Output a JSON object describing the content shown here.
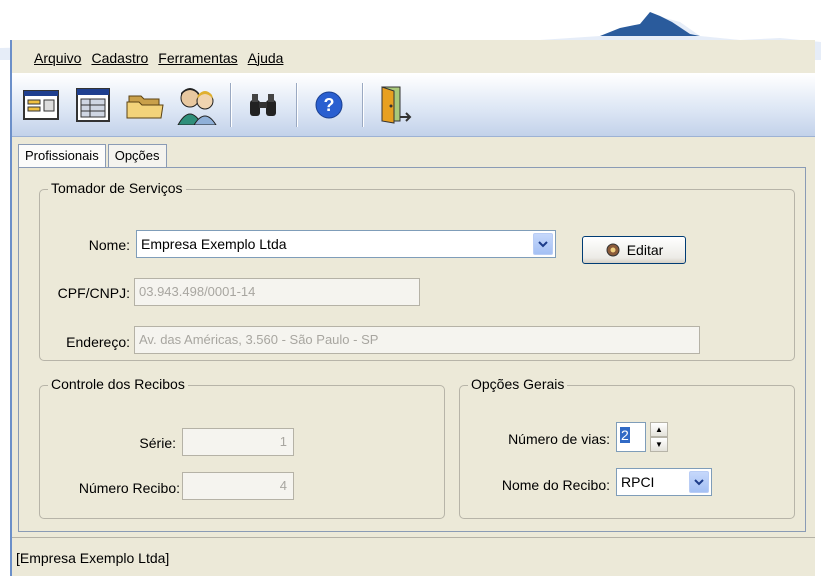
{
  "menu": {
    "items": [
      "Arquivo",
      "Cadastro",
      "Ferramentas",
      "Ajuda"
    ]
  },
  "toolbar": {
    "icons": [
      "form-icon",
      "table-icon",
      "folders-icon",
      "users-icon",
      "binoculars-icon",
      "help-icon",
      "exit-door-icon"
    ]
  },
  "tabs": [
    "Profissionais",
    "Opções"
  ],
  "tomador": {
    "legend": "Tomador de Serviços",
    "nome_label": "Nome:",
    "nome_value": "Empresa Exemplo Ltda",
    "editar_label": "Editar",
    "cpf_label": "CPF/CNPJ:",
    "cpf_value": "03.943.498/0001-14",
    "endereco_label": "Endereço:",
    "endereco_value": "Av. das Américas, 3.560 - São Paulo - SP"
  },
  "controle": {
    "legend": "Controle dos Recibos",
    "serie_label": "Série:",
    "serie_value": "1",
    "numero_label": "Número Recibo:",
    "numero_value": "4"
  },
  "opcoes": {
    "legend": "Opções Gerais",
    "vias_label": "Número de vias:",
    "vias_value": "2",
    "recibo_label": "Nome do Recibo:",
    "recibo_value": "RPCI"
  },
  "status": {
    "text": "[Empresa Exemplo Ltda]"
  },
  "colors": {
    "accent": "#316ac5",
    "window_bg": "#ece9d8",
    "toolbar_bg": "#dbe5f4"
  }
}
